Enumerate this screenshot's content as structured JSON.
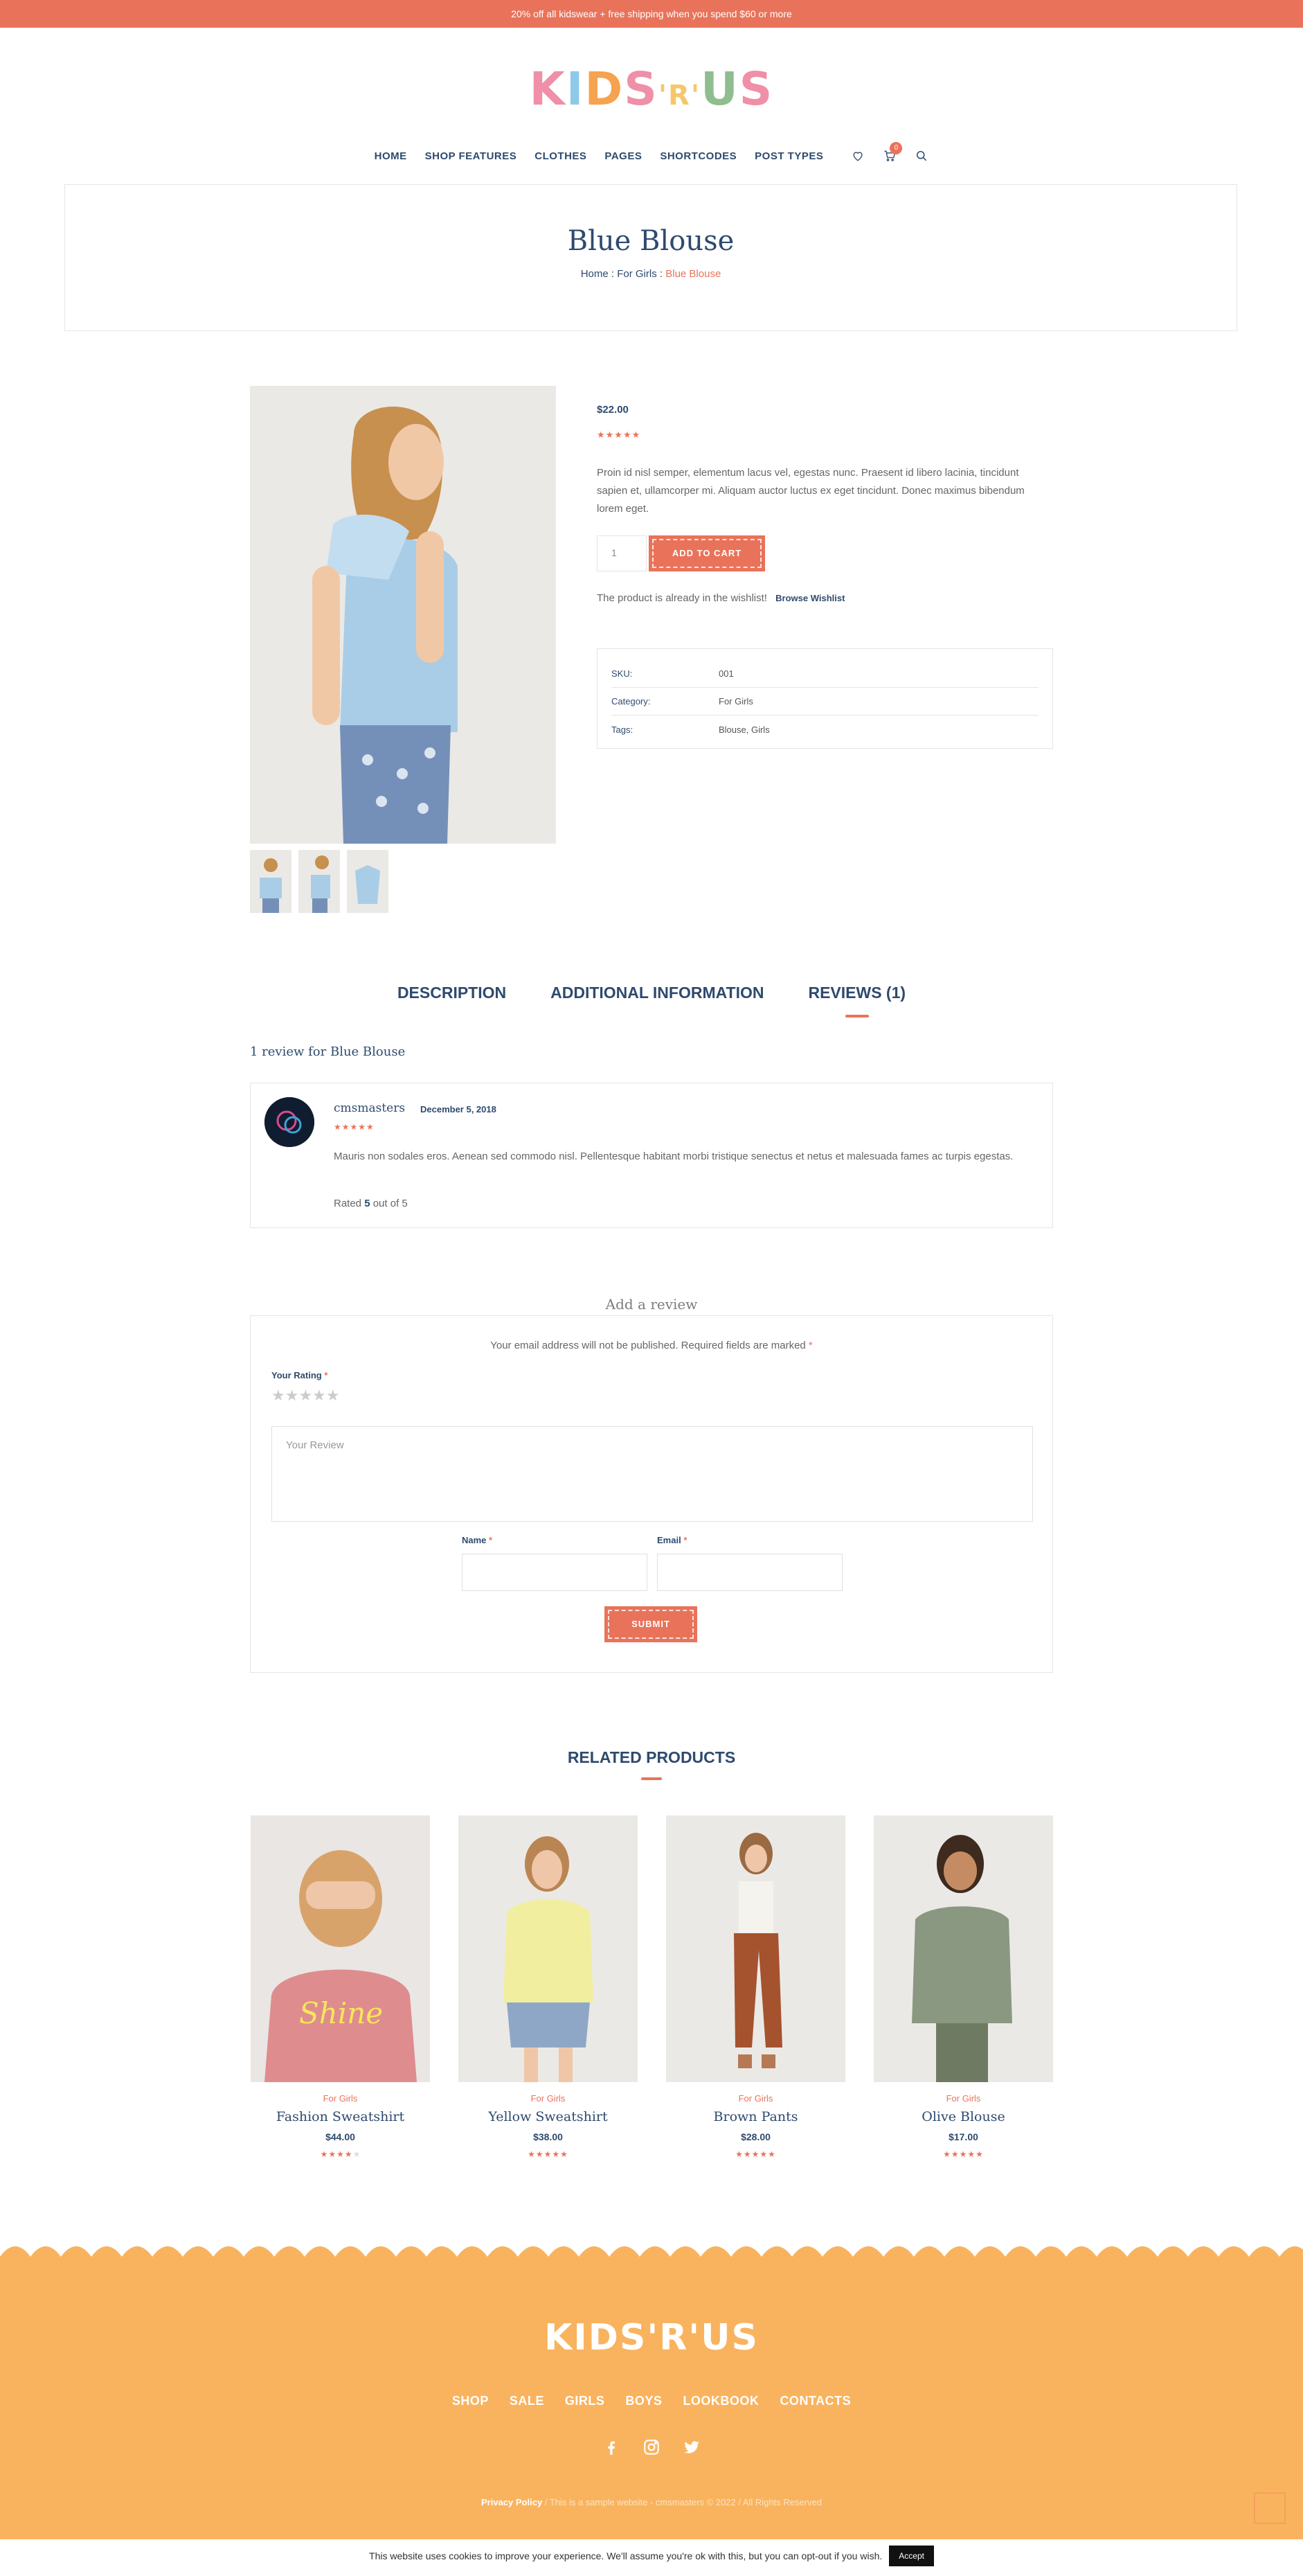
{
  "colors": {
    "accent": "#e9735a",
    "navy": "#2e4a6e",
    "footer": "#f9b35e"
  },
  "promo": "20% off all kidswear + free shipping when you spend $60 or more",
  "logo": {
    "letters": [
      "K",
      "I",
      "D",
      "S",
      "'R'",
      "U",
      "S"
    ],
    "colors": [
      "#ef8fa8",
      "#8ec9ea",
      "#f5a34e",
      "#ef8fa8",
      "#f5c76c",
      "#8fbd8f",
      "#ef8fa8"
    ]
  },
  "nav": {
    "items": [
      "HOME",
      "SHOP FEATURES",
      "CLOTHES",
      "PAGES",
      "SHORTCODES",
      "POST TYPES"
    ],
    "cart_count": "0"
  },
  "page": {
    "title": "Blue Blouse",
    "breadcrumb": {
      "home": "Home",
      "sep": ":",
      "category": "For Girls",
      "current": "Blue Blouse"
    }
  },
  "product": {
    "price": "$22.00",
    "stars": "★★★★★",
    "description": "Proin id nisl semper, elementum lacus vel, egestas nunc. Praesent id libero lacinia, tincidunt sapien et, ullamcorper mi. Aliquam auctor luctus ex eget tincidunt. Donec maximus bibendum lorem eget.",
    "quantity": "1",
    "add_to_cart": "ADD TO CART",
    "wishlist_text": "The product is already in the wishlist!",
    "wishlist_link": "Browse Wishlist",
    "meta": [
      {
        "key": "SKU:",
        "value": "001"
      },
      {
        "key": "Category:",
        "value": "For Girls"
      },
      {
        "key": "Tags:",
        "value": "Blouse, Girls"
      }
    ]
  },
  "tabs": [
    "DESCRIPTION",
    "ADDITIONAL INFORMATION",
    "REVIEWS (1)"
  ],
  "reviews": {
    "count_text": "1 review for Blue Blouse",
    "items": [
      {
        "author": "cmsmasters",
        "date": "December 5, 2018",
        "stars": "★★★★★",
        "text": "Mauris non sodales eros. Aenean sed commodo nisl. Pellentesque habitant morbi tristique senectus et netus et malesuada fames ac turpis egestas.",
        "rated_prefix": "Rated",
        "rated_value": "5",
        "rated_suffix": "out of 5"
      }
    ]
  },
  "review_form": {
    "title": "Add a review",
    "note": "Your email address will not be published. Required fields are marked",
    "rating_label": "Your Rating",
    "rating_stars": "★★★★★",
    "review_placeholder": "Your Review",
    "name_label": "Name",
    "email_label": "Email",
    "required_mark": "*",
    "submit": "SUBMIT"
  },
  "related": {
    "title": "RELATED PRODUCTS",
    "items": [
      {
        "category": "For Girls",
        "name": "Fashion Sweatshirt",
        "price": "$44.00",
        "stars": "★★★★★",
        "rating": 4
      },
      {
        "category": "For Girls",
        "name": "Yellow Sweatshirt",
        "price": "$38.00",
        "stars": "★★★★★",
        "rating": 5
      },
      {
        "category": "For Girls",
        "name": "Brown Pants",
        "price": "$28.00",
        "stars": "★★★★★",
        "rating": 5
      },
      {
        "category": "For Girls",
        "name": "Olive Blouse",
        "price": "$17.00",
        "stars": "★★★★★",
        "rating": 5
      }
    ]
  },
  "footer": {
    "logo": "KIDS'R'US",
    "nav": [
      "SHOP",
      "SALE",
      "GIRLS",
      "BOYS",
      "LOOKBOOK",
      "CONTACTS"
    ],
    "social_icons": [
      "facebook-icon",
      "instagram-icon",
      "twitter-icon"
    ],
    "privacy": "Privacy Policy",
    "copyright": " / This is a sample website - cmsmasters © 2022 / All Rights Reserved"
  },
  "cookie": {
    "text": "This website uses cookies to improve your experience. We'll assume you're ok with this, but you can opt-out if you wish.",
    "accept": "Accept"
  }
}
